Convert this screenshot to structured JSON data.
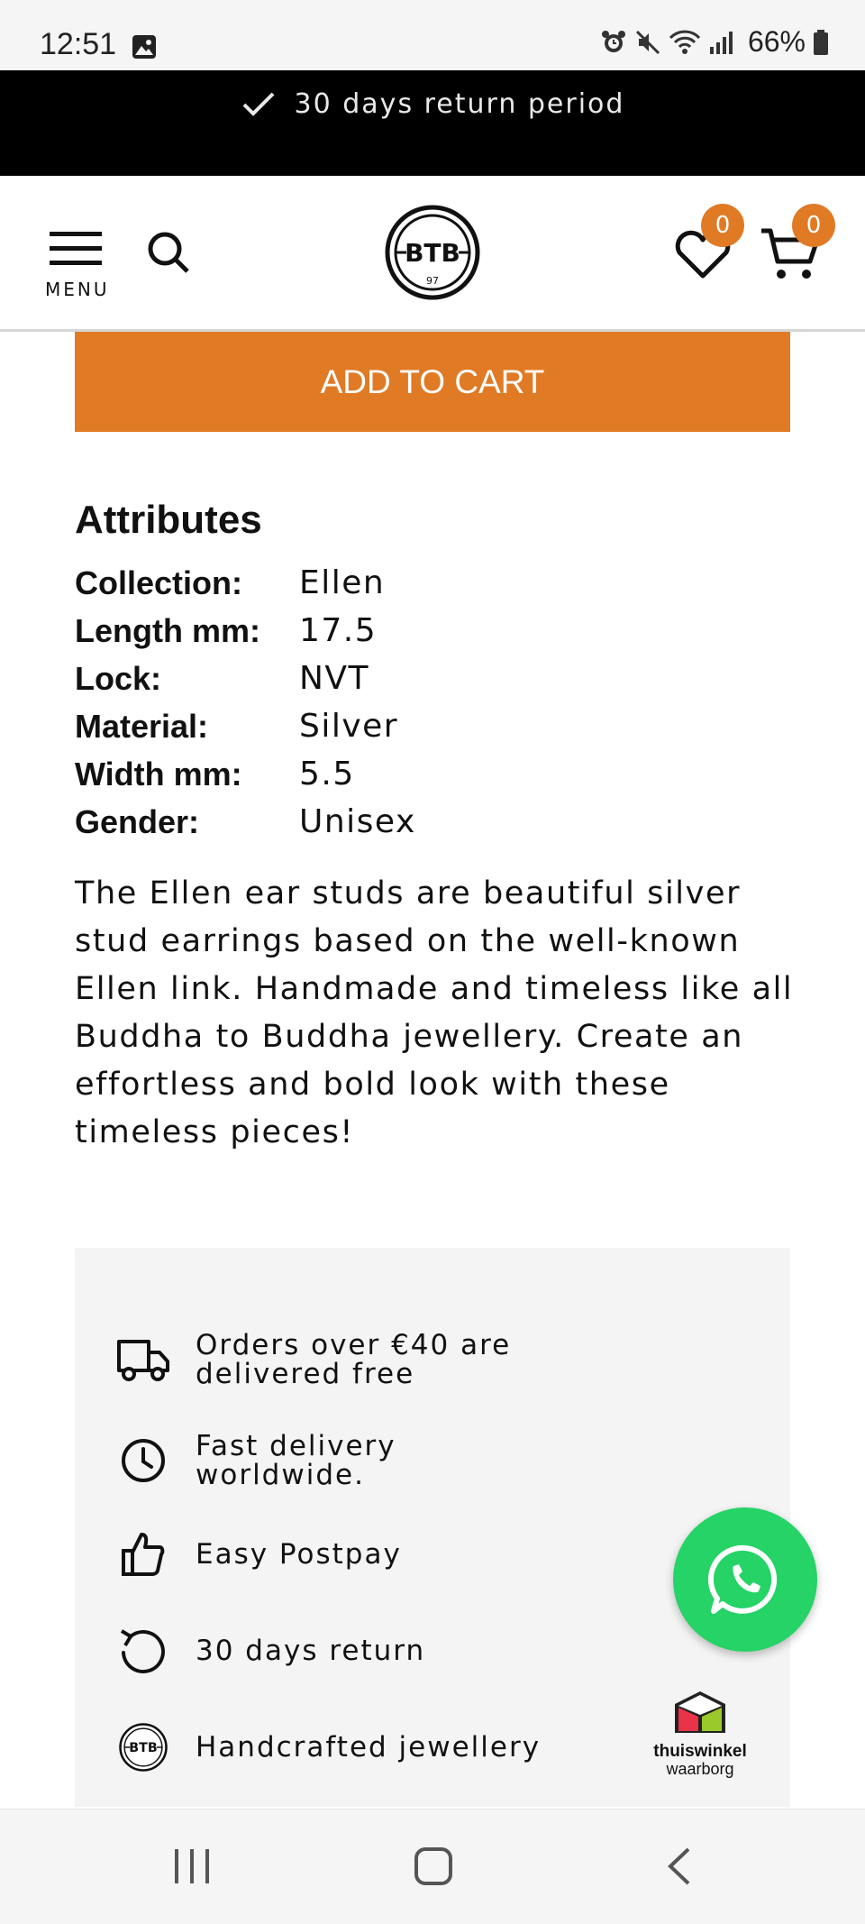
{
  "status_bar": {
    "time": "12:51",
    "battery": "66%"
  },
  "announcement": {
    "text": "30 days return period"
  },
  "header": {
    "menu_label": "MENU",
    "wishlist_count": "0",
    "cart_count": "0",
    "logo_text": "BTB",
    "logo_sub": "97"
  },
  "product": {
    "add_to_cart": "ADD TO CART"
  },
  "attributes": {
    "title": "Attributes",
    "rows": [
      {
        "key": "Collection:",
        "value": "Ellen"
      },
      {
        "key": "Length mm:",
        "value": "17.5"
      },
      {
        "key": "Lock:",
        "value": "NVT"
      },
      {
        "key": "Material:",
        "value": "Silver"
      },
      {
        "key": "Width mm:",
        "value": "5.5"
      },
      {
        "key": "Gender:",
        "value": "Unisex"
      }
    ]
  },
  "description": "The Ellen ear studs are beautiful silver stud earrings based on the well-known Ellen link. Handmade and timeless like all Buddha to Buddha jewellery. Create an effortless and bold look with these timeless pieces!",
  "benefits": [
    {
      "icon": "truck-icon",
      "text": "Orders over €40 are delivered free"
    },
    {
      "icon": "clock-icon",
      "text": "Fast delivery worldwide."
    },
    {
      "icon": "thumbs-up-icon",
      "text": "Easy Postpay"
    },
    {
      "icon": "return-icon",
      "text": "30 days return"
    },
    {
      "icon": "btb-logo-icon",
      "text": "Handcrafted jewellery"
    }
  ],
  "trust_badge": {
    "brand": "thuiswinkel",
    "sub": "waarborg"
  },
  "colors": {
    "accent": "#e07a25",
    "whatsapp": "#25d366",
    "announcement_bg": "#000000",
    "benefits_bg": "#f4f4f4"
  }
}
